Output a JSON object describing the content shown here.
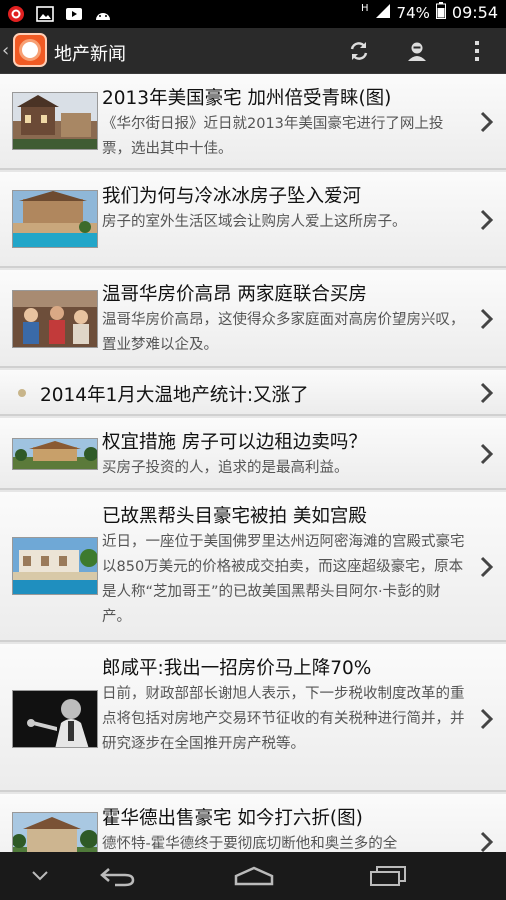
{
  "status_bar": {
    "battery": "74%",
    "time": "09:54"
  },
  "action_bar": {
    "title": "地产新闻"
  },
  "news": [
    {
      "title": "2013年美国豪宅 加州倍受青睐(图)",
      "summary": "《华尔街日报》近日就2013年美国豪宅进行了网上投票，选出其中十佳。"
    },
    {
      "title": "我们为何与冷冰冰房子坠入爱河",
      "summary": "房子的室外生活区域会让购房人爱上这所房子。"
    },
    {
      "title": "温哥华房价高昂 两家庭联合买房",
      "summary": "温哥华房价高昂，这使得众多家庭面对高房价望房兴叹，置业梦难以企及。"
    },
    {
      "title": "2014年1月大温地产统计:又涨了",
      "summary": ""
    },
    {
      "title": "权宜措施 房子可以边租边卖吗？",
      "summary": "买房子投资的人，追求的是最高利益。"
    },
    {
      "title": "已故黑帮头目豪宅被拍 美如宫殿",
      "summary": "近日，一座位于美国佛罗里达州迈阿密海滩的宫殿式豪宅以850万美元的价格被成交拍卖，而这座超级豪宅，原本是人称“芝加哥王”的已故美国黑帮头目阿尔·卡彭的财产。"
    },
    {
      "title": "郎咸平:我出一招房价马上降70%",
      "summary": "日前，财政部部长谢旭人表示，下一步税收制度改革的重点将包括对房地产交易环节征收的有关税种进行简并，并研究逐步在全国推开房产税等。"
    },
    {
      "title": "霍华德出售豪宅 如今打六折(图)",
      "summary": "德怀特-霍华德终于要彻底切断他和奥兰多的全"
    }
  ]
}
